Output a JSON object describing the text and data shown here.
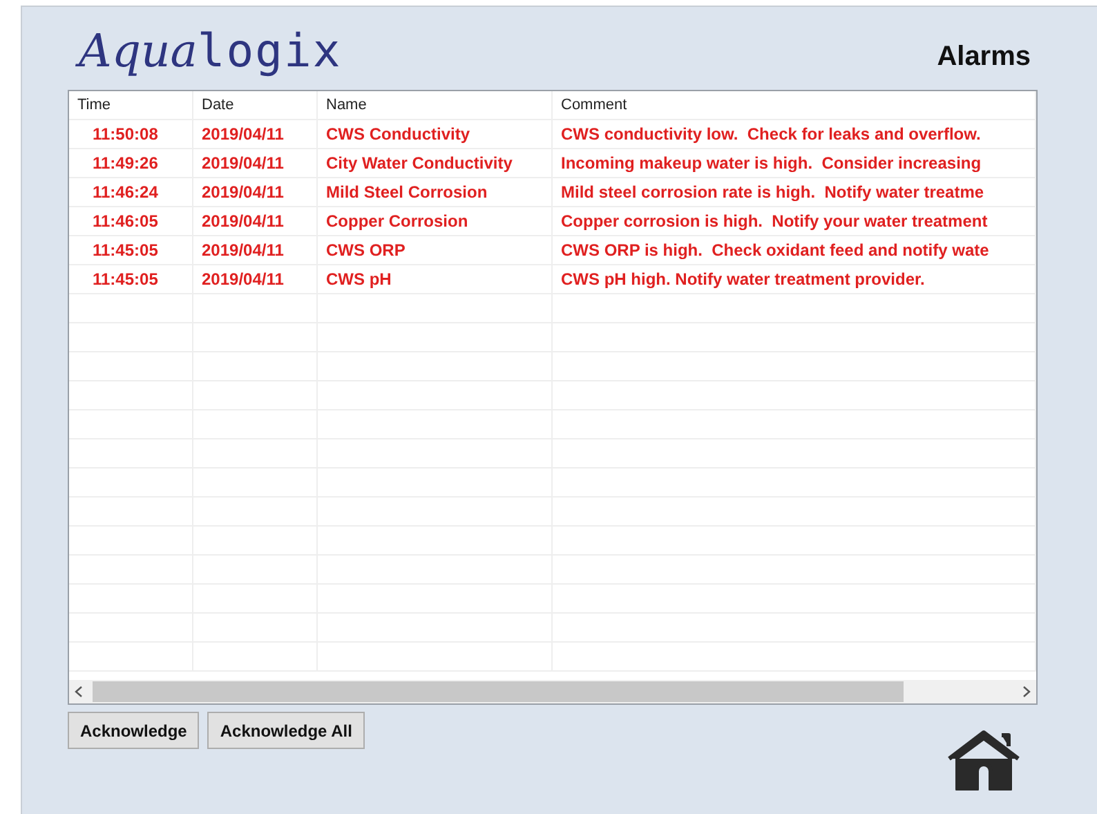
{
  "logo": {
    "script_part": "Aqua",
    "plain_part": "logix"
  },
  "title": "Alarms",
  "table": {
    "columns": [
      "Time",
      "Date",
      "Name",
      "Comment"
    ],
    "rows": [
      [
        "11:50:08",
        "2019/04/11",
        "CWS Conductivity",
        "CWS conductivity low.  Check for leaks and overflow."
      ],
      [
        "11:49:26",
        "2019/04/11",
        "City Water Conductivity",
        "Incoming makeup water is high.  Consider increasing"
      ],
      [
        "11:46:24",
        "2019/04/11",
        "Mild Steel Corrosion",
        "Mild steel corrosion rate is high.  Notify water treatme"
      ],
      [
        "11:46:05",
        "2019/04/11",
        "Copper Corrosion",
        "Copper corrosion is high.  Notify your water treatment"
      ],
      [
        "11:45:05",
        "2019/04/11",
        "CWS ORP",
        "CWS ORP is high.  Check oxidant feed and notify wate"
      ],
      [
        "11:45:05",
        "2019/04/11",
        "CWS pH",
        "CWS pH high. Notify water treatment provider."
      ]
    ]
  },
  "buttons": [
    "Acknowledge",
    "Acknowledge All"
  ]
}
